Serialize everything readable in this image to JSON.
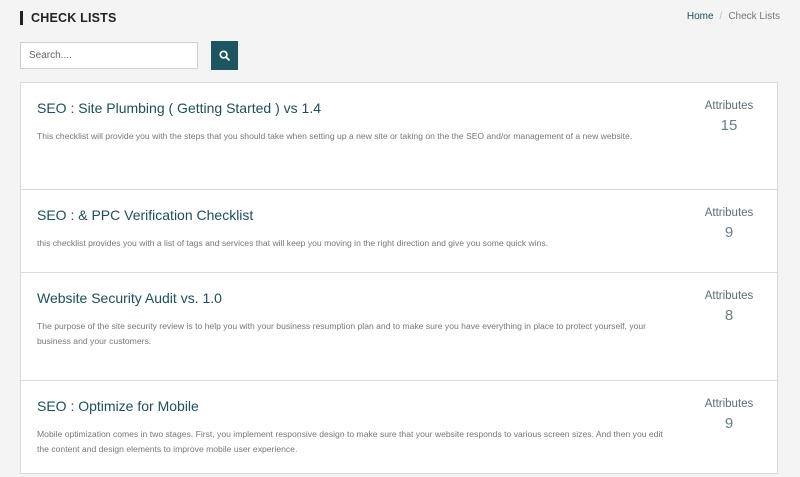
{
  "header": {
    "title": "CHECK LISTS",
    "breadcrumb": {
      "home": "Home",
      "separator": "/",
      "current": "Check Lists"
    }
  },
  "search": {
    "placeholder": "Search....",
    "value": ""
  },
  "colors": {
    "accent": "#1d5561",
    "title": "#1d4f5c"
  },
  "checklists": [
    {
      "title": "SEO : Site Plumbing ( Getting Started ) vs 1.4",
      "description": "This checklist will provide you with the steps that you should take when setting up a new site or taking on the the SEO and/or management of a new website.",
      "attributes_label": "Attributes",
      "attributes_count": "15"
    },
    {
      "title": "SEO : & PPC Verification Checklist",
      "description": "this checklist provides you with a list of tags and services that will keep you moving in the right direction and give you some quick wins.",
      "attributes_label": "Attributes",
      "attributes_count": "9"
    },
    {
      "title": "Website Security Audit vs. 1.0",
      "description": "The purpose of the site security review is to help you with your business resumption plan and to make sure you have everything in place to protect yourself, your business and your customers.",
      "attributes_label": "Attributes",
      "attributes_count": "8"
    },
    {
      "title": "SEO : Optimize for Mobile",
      "description": "Mobile optimization comes in two stages. First, you implement responsive design to make sure that your website responds to various screen sizes. And then you edit the content and design elements to improve mobile user experience.",
      "attributes_label": "Attributes",
      "attributes_count": "9"
    }
  ]
}
